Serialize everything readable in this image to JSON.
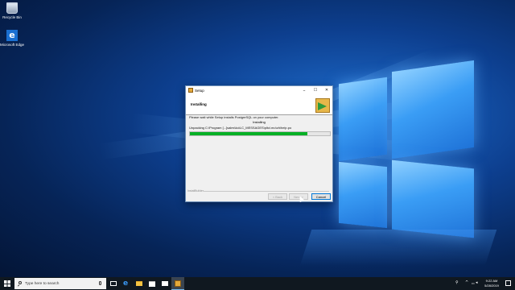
{
  "desktop": {
    "icons": [
      {
        "label": "Recycle Bin"
      },
      {
        "label": "Microsoft Edge",
        "glyph": "e"
      }
    ]
  },
  "dialog": {
    "title": "Setup",
    "window_controls": {
      "minimize": "–",
      "maximize": "☐",
      "close": "✕"
    },
    "header_title": "Installing",
    "line1": "Please wait while Setup installs PostgreSQL on your computer.",
    "status": "Installing",
    "detail": "Unpacking C:\\Program [...]sales\\ko\\LC_MESSAGES\\pltcl.mo\\zh\\help.po",
    "progress": 0.84,
    "footer_label": "InstallBuilder",
    "buttons": {
      "back": "< Back",
      "next": "Next >",
      "cancel": "Cancel"
    }
  },
  "taskbar": {
    "search_placeholder": "Type here to search",
    "clock_time": "9:22 AM",
    "clock_date": "5/28/2019",
    "pinned": [
      "task-view-icon",
      "edge-icon",
      "file-explorer-icon",
      "store-icon",
      "mail-icon",
      "setup-app-icon"
    ]
  },
  "colors": {
    "accent": "#0078d7",
    "progress": "#06b025",
    "taskbar": "#101820"
  }
}
